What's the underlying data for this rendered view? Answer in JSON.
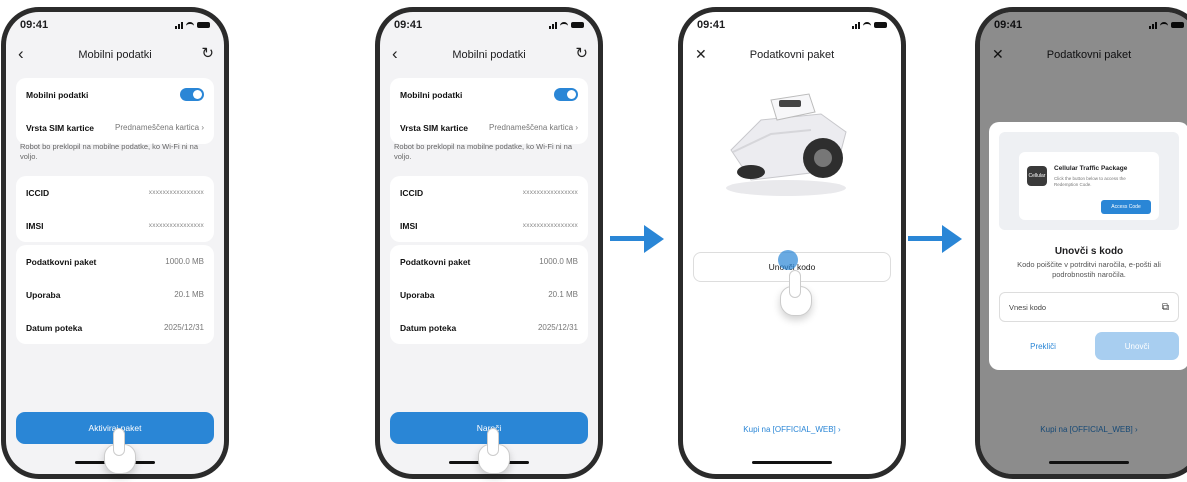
{
  "status": {
    "time": "09:41"
  },
  "screen1": {
    "title": "Mobilni podatki",
    "mobile_data_label": "Mobilni podatki",
    "sim_label": "Vrsta SIM kartice",
    "sim_value": "Prednameščena kartica",
    "note": "Robot bo preklopil na mobilne podatke, ko Wi-Fi ni na voljo.",
    "iccid_label": "ICCID",
    "iccid_value": "xxxxxxxxxxxxxxxx",
    "imsi_label": "IMSI",
    "imsi_value": "xxxxxxxxxxxxxxxx",
    "package_label": "Podatkovni paket",
    "package_value": "1000.0 MB",
    "usage_label": "Uporaba",
    "usage_value": "20.1 MB",
    "expiry_label": "Datum poteka",
    "expiry_value": "2025/12/31",
    "button_label": "Aktiviraj paket"
  },
  "screen2": {
    "button_label": "Naroči"
  },
  "screen3": {
    "title": "Podatkovni paket",
    "redeem_label": "Unovči kodo",
    "buy_link": "Kupi na [OFFICIAL_WEB]"
  },
  "screen4": {
    "promo_title": "Cellular Traffic Package",
    "promo_desc": "Click the button below to access the Redemption Code.",
    "promo_icon_text": "Cellular",
    "promo_button": "Access Code",
    "modal_title": "Unovči s kodo",
    "modal_desc": "Kodo poiščite v potrditvi naročila, e-pošti ali podrobnostih naročila.",
    "input_placeholder": "Vnesi kodo",
    "cancel_label": "Prekliči",
    "redeem_label": "Unovči"
  },
  "colors": {
    "accent": "#2a86d6",
    "accent_disabled": "#a8cef0"
  },
  "icons": [
    "back-icon",
    "refresh-icon",
    "close-icon",
    "chevron-right-icon",
    "copy-icon",
    "arrow-right-icon",
    "hand-pointer-icon"
  ]
}
